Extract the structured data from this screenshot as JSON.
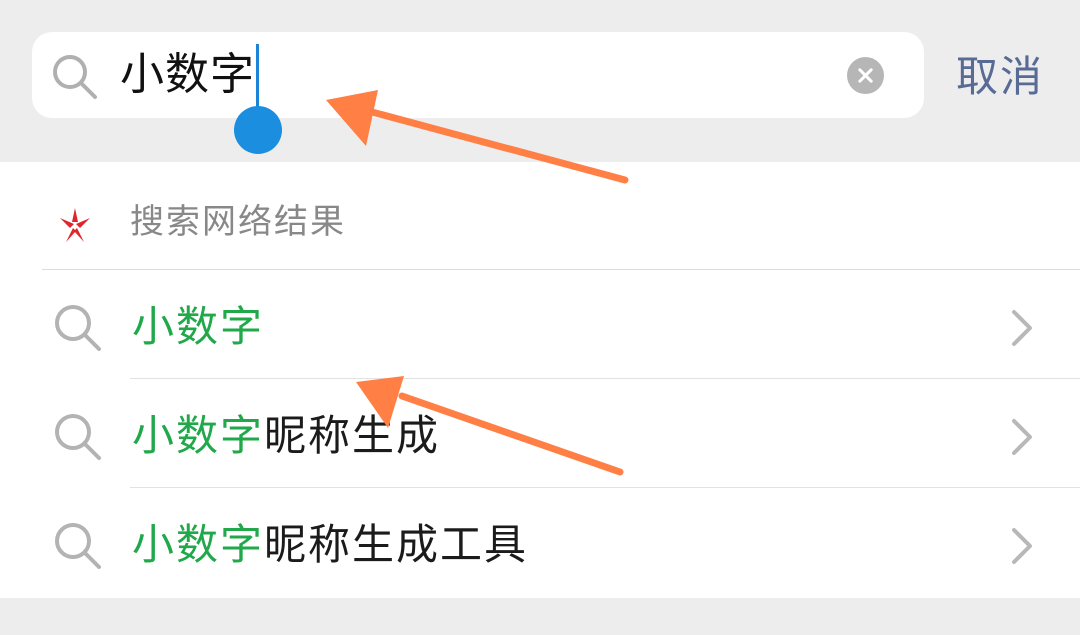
{
  "search": {
    "query": "小数字",
    "cancel_label": "取消"
  },
  "web_results": {
    "title": "搜索网络结果"
  },
  "suggestions": [
    {
      "highlight": "小数字",
      "rest": ""
    },
    {
      "highlight": "小数字",
      "rest": "昵称生成"
    },
    {
      "highlight": "小数字",
      "rest": "昵称生成工具"
    }
  ],
  "colors": {
    "highlight": "#20a84a",
    "cancel": "#576b95",
    "caret": "#1b8ee0",
    "arrow": "#ff7f45",
    "web_logo": "#e0262d"
  },
  "icons": {
    "search": "search-icon",
    "clear": "clear-icon",
    "web_logo": "web-search-logo-icon",
    "chevron": "chevron-right-icon"
  }
}
